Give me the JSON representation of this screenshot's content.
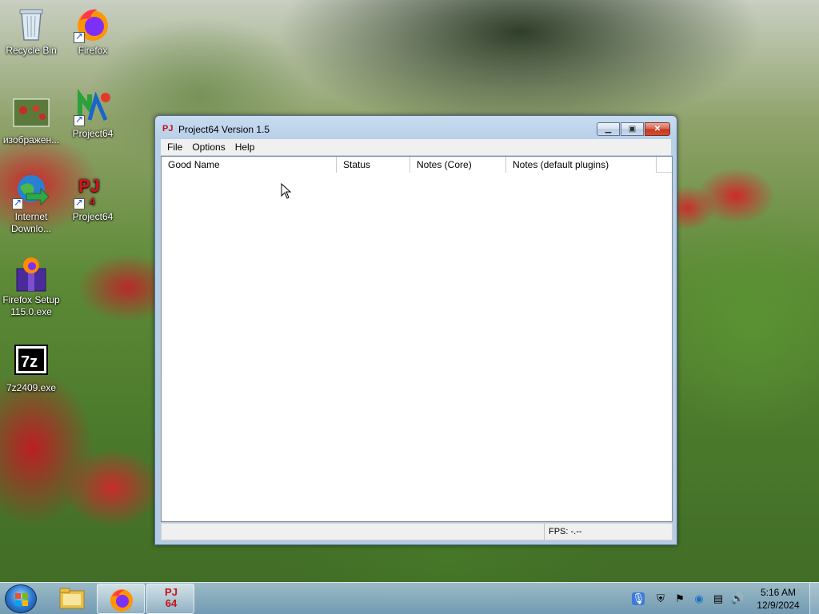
{
  "desktop": {
    "icons": [
      {
        "label": "Recycle Bin"
      },
      {
        "label": "Firefox"
      },
      {
        "label": "изображен..."
      },
      {
        "label": "Project64"
      },
      {
        "label": "Internet Downlo..."
      },
      {
        "label": "Project64"
      },
      {
        "label": "Firefox Setup 115.0.exe"
      },
      {
        "label": "7z2409.exe"
      }
    ]
  },
  "window": {
    "icon_text": "PJ",
    "title": "Project64 Version 1.5",
    "menu": [
      "File",
      "Options",
      "Help"
    ],
    "columns": [
      "Good Name",
      "Status",
      "Notes (Core)",
      "Notes (default plugins)"
    ],
    "status_fps": "FPS: -.--"
  },
  "taskbar": {
    "project64_label": "PJ 64",
    "time": "5:16 AM",
    "date": "12/9/2024"
  }
}
